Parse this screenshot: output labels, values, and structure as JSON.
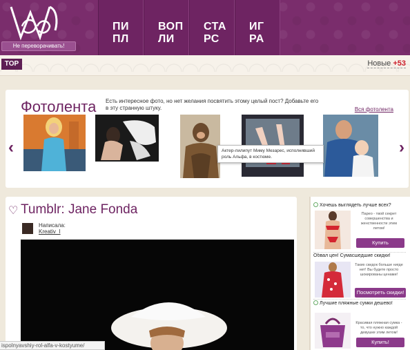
{
  "header": {
    "logo_sub": "Не переворачивать!",
    "nav": [
      {
        "l1": "ПИ",
        "l2": "ПЛ"
      },
      {
        "l1": "ВОП",
        "l2": "ЛИ"
      },
      {
        "l1": "СТА",
        "l2": "РС"
      },
      {
        "l1": "ИГ",
        "l2": "РА"
      }
    ]
  },
  "strip": {
    "top_label": "TOP",
    "new_label": "Новые",
    "new_count": "+53"
  },
  "feed": {
    "title": "Фотолента",
    "description": "Есть интересное фото, но нет желания посвятить этому целый пост? Добавьте его в эту странную штуку.",
    "all_link": "Вся фотолента",
    "tooltip": "Актер-лилипут Миму Мезарес, исполнявший роль Альфа, в костюме.",
    "prev": "‹",
    "next": "›"
  },
  "post": {
    "title": "Tumblr: Jane Fonda",
    "author_label": "Написала:",
    "author_name": "Kreativ_I"
  },
  "status_url": "ispolnyavshiy-rol-alfa-v-kostyume/",
  "ads": [
    {
      "title": "Хочешь выглядеть лучше всех?",
      "text": "Парео - твой секрет совершенства и женственности этим летом!",
      "button": "Купить"
    },
    {
      "title": "Обвал цен! Сумасшедшие скидки!",
      "text": "Таких скидок больше нигде нет! Вы будете просто шокированы ценами!",
      "button": "Посмотреть скидки!"
    },
    {
      "title": "Лучшие пляжные сумки дешево!",
      "text": "Красивая пляжная сумка - то, что нужно каждой девушке этим летом!",
      "button": "Купить!"
    }
  ]
}
